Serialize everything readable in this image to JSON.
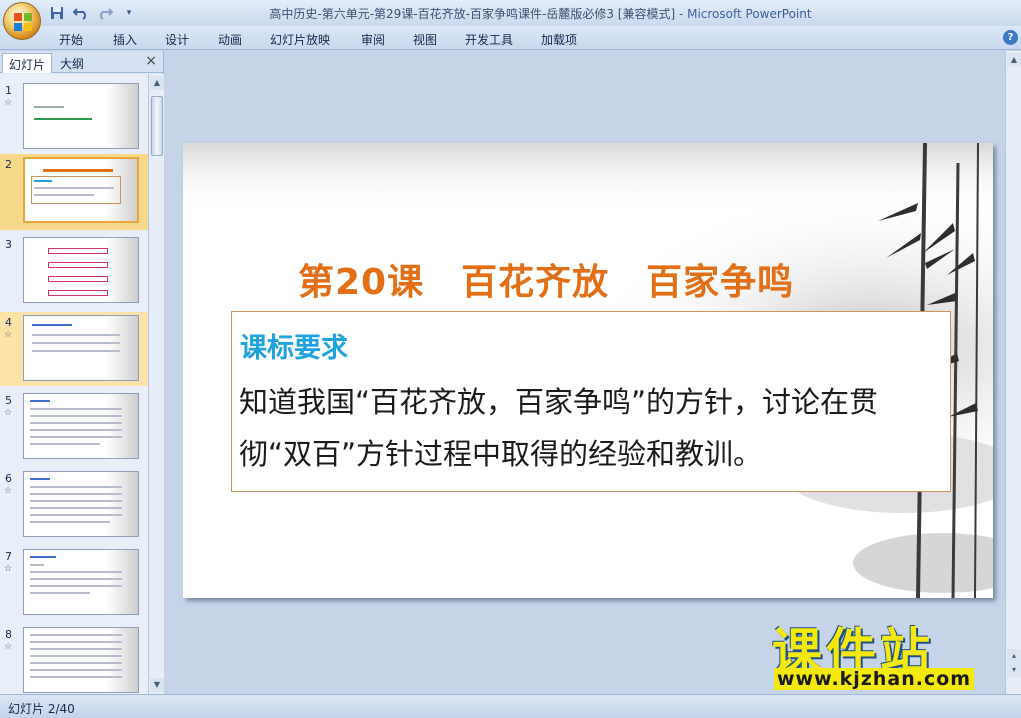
{
  "window": {
    "title": "高中历史-第六单元-第29课-百花齐放-百家争鸣课件-岳麓版必修3 [兼容模式]",
    "title_suffix": " - Microsoft PowerPoint"
  },
  "quick_access": {
    "icons": [
      "save-icon",
      "undo-icon",
      "redo-icon",
      "customize-icon"
    ]
  },
  "ribbon": {
    "tabs": [
      "开始",
      "插入",
      "设计",
      "动画",
      "幻灯片放映",
      "审阅",
      "视图",
      "开发工具",
      "加载项"
    ]
  },
  "panel": {
    "tab_slides": "幻灯片",
    "tab_outline": "大纲",
    "close_label": "×"
  },
  "thumbnails": {
    "numbers": [
      "1",
      "2",
      "3",
      "4",
      "5",
      "6",
      "7",
      "8"
    ],
    "selected": "2"
  },
  "slide": {
    "title": "第20课　百花齐放　百家争鸣",
    "requirement_heading": "课标要求",
    "requirement_body": "知道我国“百花齐放，百家争鸣”的方针，讨论在贯彻“双百”方针过程中取得的经验和教训。"
  },
  "status": {
    "slide_counter": "幻灯片 2/40"
  },
  "watermark": {
    "brand": "课件站",
    "url": "www.kjzhan.com"
  },
  "colors": {
    "title_orange": "#e26e16",
    "heading_blue": "#1ea2e0",
    "ribbon_blue": "#c8d8ee",
    "watermark_yellow": "#f5e80b"
  }
}
